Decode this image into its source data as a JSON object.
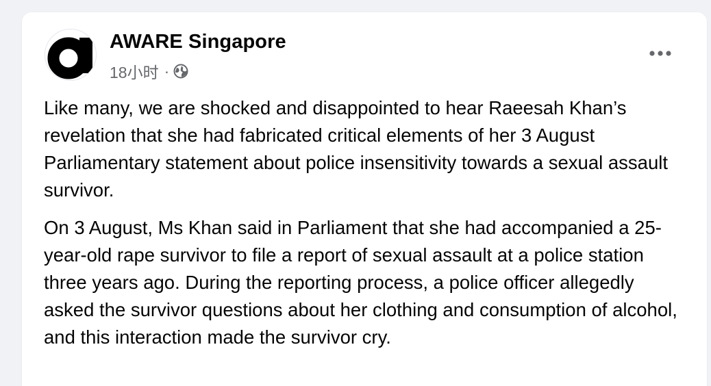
{
  "post": {
    "author": "AWARE Singapore",
    "timestamp": "18小时",
    "separator": "·",
    "icons": {
      "avatar": "aware-logo",
      "audience": "globe-icon",
      "menu": "more-options-icon"
    },
    "paragraphs": [
      "Like many, we are shocked and disappointed to hear Raeesah Khan’s revelation that she had fabricated critical elements of her 3 August Parliamentary statement about police insensitivity towards a sexual assault survivor.",
      "On 3 August, Ms Khan said in Parliament that she had accompanied a 25-year-old rape survivor to file a report of sexual assault at a police station three years ago. During the reporting process, a police officer allegedly asked the survivor questions about her clothing and consumption of alcohol, and this interaction made the survivor cry."
    ]
  },
  "colors": {
    "background": "#f0f2f5",
    "card": "#ffffff",
    "text_primary": "#050505",
    "text_secondary": "#65676b",
    "logo": "#000000"
  }
}
